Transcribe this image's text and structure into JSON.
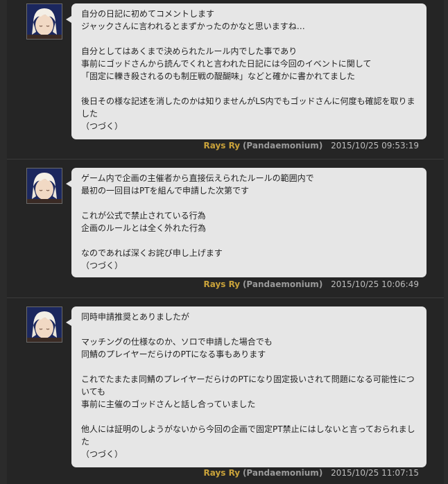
{
  "comments": [
    {
      "text": "自分の日記に初めてコメントします\nジャックさんに言われるとまずかったのかなと思いますね…\n\n自分としてはあくまで決められたルール内でした事であり\n事前にゴッドさんから読んでくれと言われた日記には今回のイベントに関して\n「固定に轢き殺されるのも制圧戦の醍醐味」などと確かに書かれてました\n\n後日その様な記述を消したのかは知りませんがLS内でもゴッドさんに何度も確認を取りました\n（つづく）",
      "author": "Rays Ry",
      "world": "(Pandaemonium)",
      "timestamp": "2015/10/25 09:53:19"
    },
    {
      "text": "ゲーム内で企画の主催者から直接伝えられたルールの範囲内で\n最初の一回目はPTを組んで申請した次第です\n\nこれが公式で禁止されている行為\n企画のルールとは全く外れた行為\n\nなのであれば深くお詫び申し上げます\n（つづく）",
      "author": "Rays Ry",
      "world": "(Pandaemonium)",
      "timestamp": "2015/10/25 10:06:49"
    },
    {
      "text": "同時申請推奨とありましたが\n\nマッチングの仕様なのか、ソロで申請した場合でも\n同鯖のプレイヤーだらけのPTになる事もあります\n\nこれでたまたま同鯖のプレイヤーだらけのPTになり固定扱いされて問題になる可能性についても\n事前に主催のゴッドさんと話し合っていました\n\n他人には証明のしようがないから今回の企画で固定PT禁止にはしないと言っておられました\n（つづく）",
      "author": "Rays Ry",
      "world": "(Pandaemonium)",
      "timestamp": "2015/10/25 11:07:15"
    }
  ]
}
